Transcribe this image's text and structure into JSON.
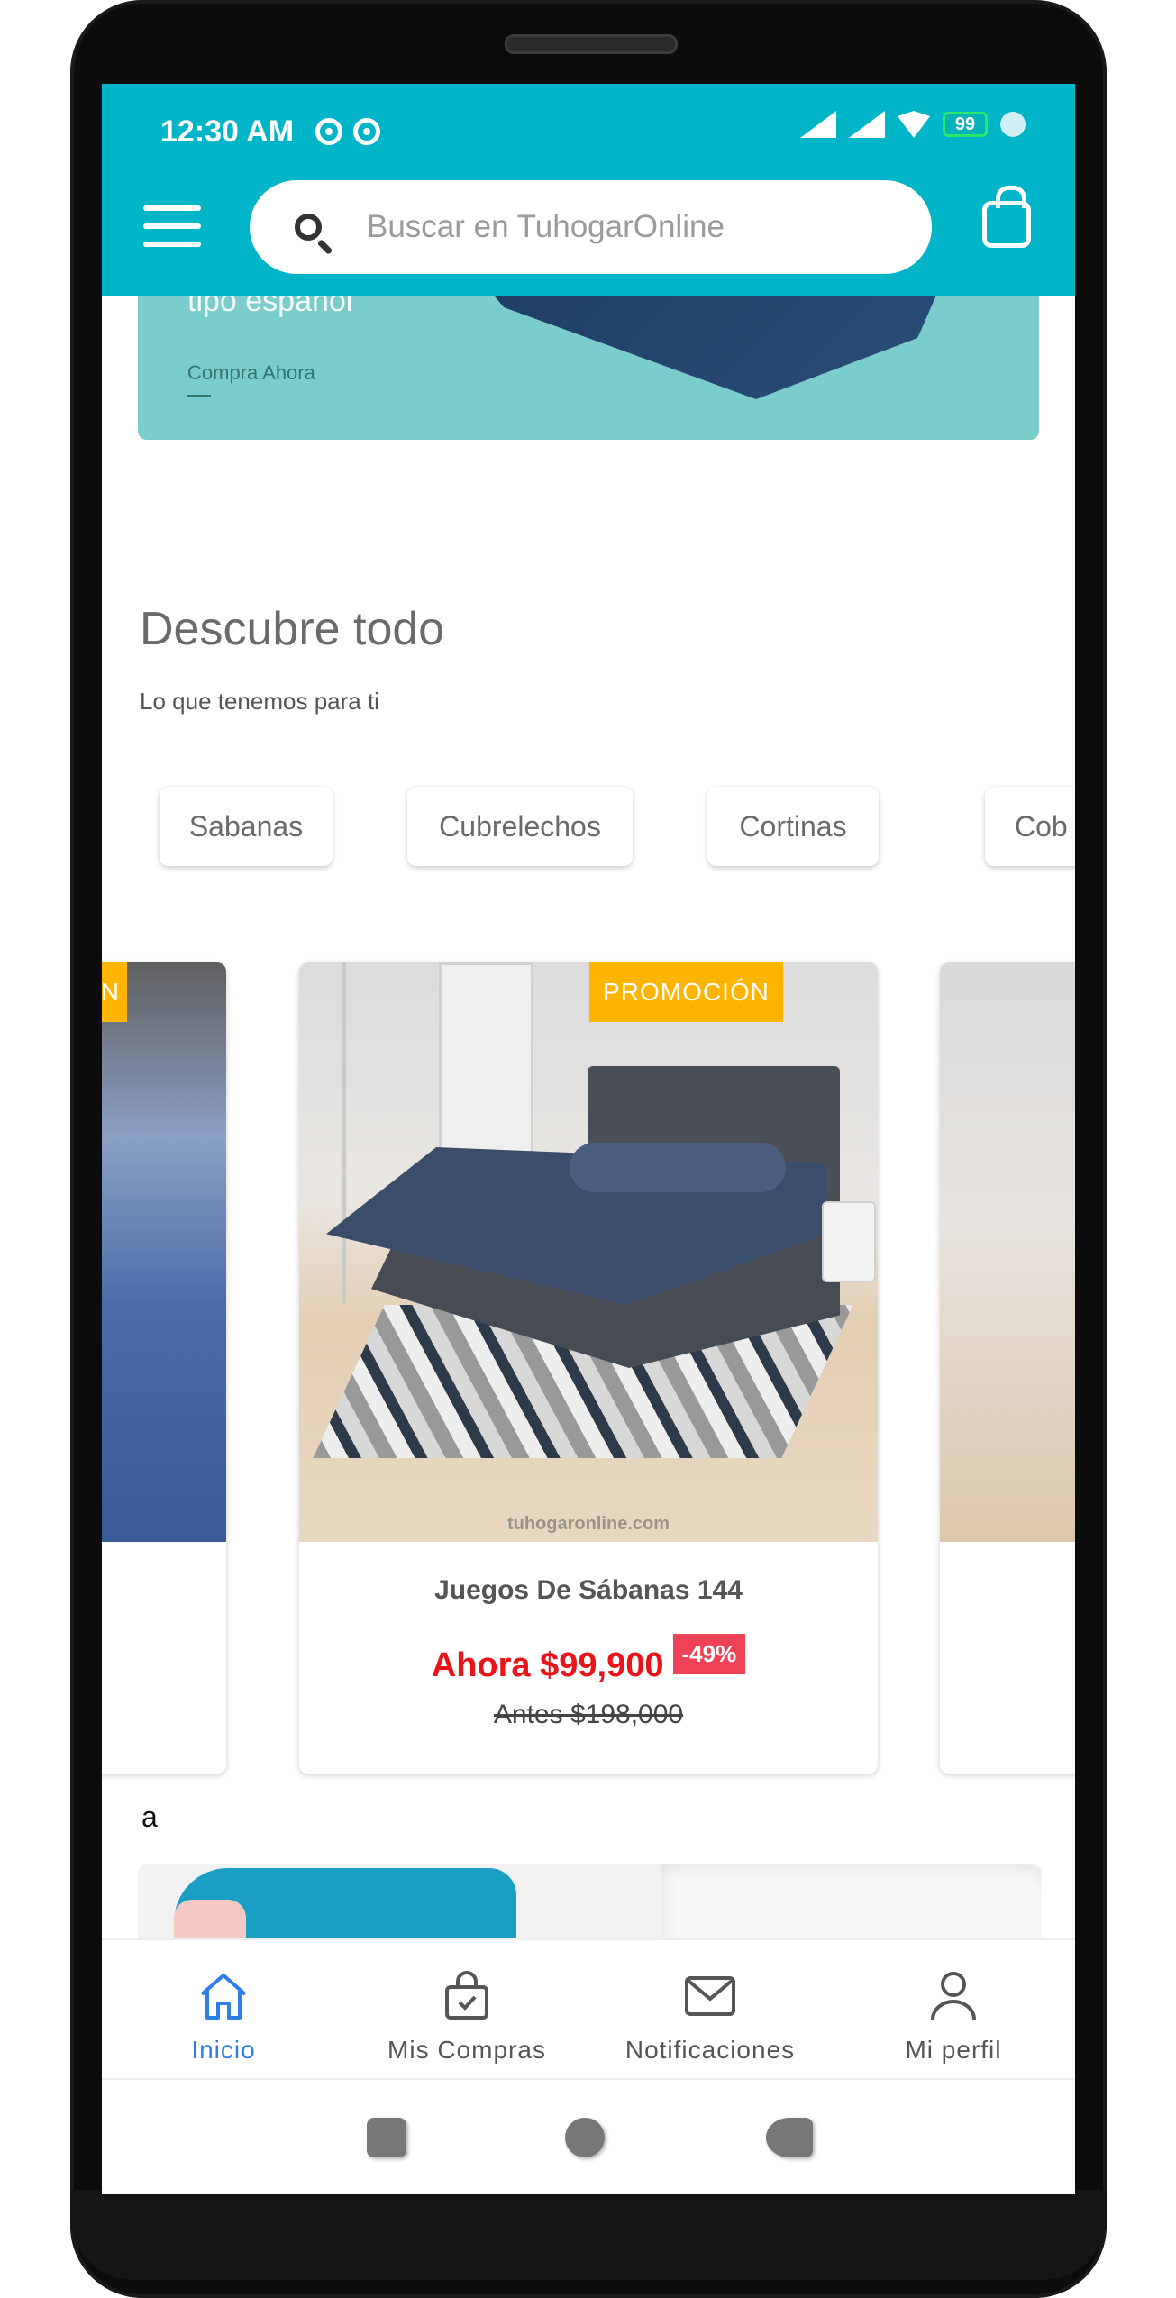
{
  "status_bar": {
    "time": "12:30 AM",
    "battery": "99"
  },
  "header": {
    "search_placeholder": "Buscar en TuhogarOnline",
    "accent_color": "#00b5c7"
  },
  "banner": {
    "subtitle": "tipo español",
    "cta": "Compra Ahora"
  },
  "discover": {
    "title": "Descubre todo",
    "subtitle": "Lo que tenemos para ti",
    "categories": [
      "Sabanas",
      "Cubrelechos",
      "Cortinas",
      "Cob"
    ]
  },
  "products": {
    "left_badge": "N",
    "main": {
      "badge": "PROMOCIÓN",
      "watermark": "tuhogaronline.com",
      "name": "Juegos De Sábanas 144",
      "price_now": "Ahora $99,900",
      "discount": "-49%",
      "price_before": "Antes $198,000"
    }
  },
  "misc_text": "a",
  "bottom_nav": {
    "items": [
      {
        "label": "Inicio",
        "icon": "home-icon",
        "active": true
      },
      {
        "label": "Mis Compras",
        "icon": "shopping-bag-check-icon",
        "active": false
      },
      {
        "label": "Notificaciones",
        "icon": "envelope-icon",
        "active": false
      },
      {
        "label": "Mi perfil",
        "icon": "user-icon",
        "active": false
      }
    ],
    "active_color": "#2d7ee8"
  }
}
